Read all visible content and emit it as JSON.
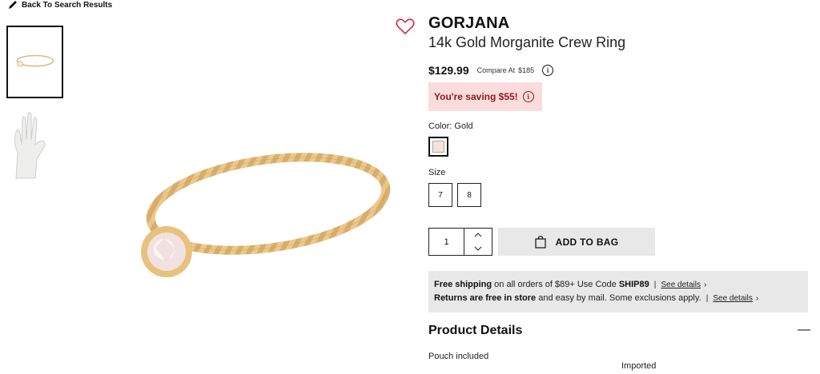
{
  "nav": {
    "back_label": "Back To Search Results"
  },
  "product": {
    "brand": "GORJANA",
    "title": "14k Gold Morganite Crew Ring",
    "price": "$129.99",
    "compare_label": "Compare At",
    "compare_price": "$185",
    "saving_text": "You're saving $55!"
  },
  "color": {
    "label": "Color:",
    "value": "Gold"
  },
  "size": {
    "label": "Size",
    "options": [
      "7",
      "8"
    ]
  },
  "quantity": {
    "value": "1"
  },
  "cart": {
    "add_label": "ADD TO BAG"
  },
  "shipping": {
    "line1_bold": "Free shipping",
    "line1_text": " on all orders of $89+ Use Code ",
    "line1_code": "SHIP89",
    "separator": "|",
    "see_details": "See details",
    "chevron": "›",
    "line2_bold": "Returns are free in store",
    "line2_text": " and easy by mail. Some exclusions apply."
  },
  "details": {
    "title": "Product Details",
    "toggle": "—",
    "items": [
      "Pouch included",
      "Imported"
    ]
  },
  "icons": {
    "back": "pencil-icon",
    "favorite": "heart-icon",
    "info": "info-icon",
    "bag": "shopping-bag-icon"
  },
  "colors": {
    "accent_red": "#d6283a",
    "saving_bg": "#fbdcdc",
    "saving_text": "#8b1c1c",
    "panel_bg": "#e8e8e8"
  }
}
